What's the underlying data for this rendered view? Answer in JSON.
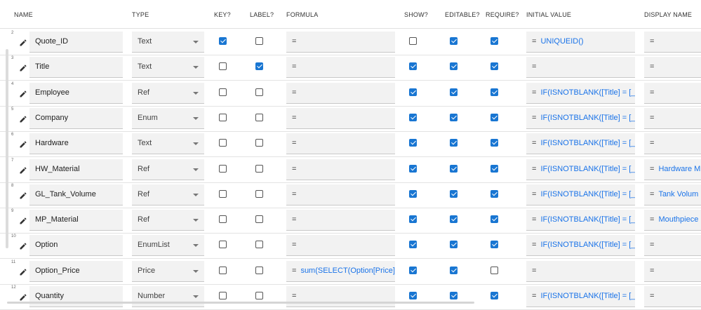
{
  "columns": {
    "name": "NAME",
    "type": "TYPE",
    "key": "KEY?",
    "label": "LABEL?",
    "formula": "FORMULA",
    "show": "SHOW?",
    "editable": "EDITABLE?",
    "require": "REQUIRE?",
    "initial": "INITIAL VALUE",
    "display": "DISPLAY NAME"
  },
  "eq": "=",
  "colors": {
    "accent": "#1976d2",
    "expression": "#1a73e8"
  },
  "rows": [
    {
      "num": "2",
      "name": "Quote_ID",
      "type": "Text",
      "key": true,
      "label": false,
      "formula": "",
      "show": false,
      "editable": true,
      "require": true,
      "initial": "UNIQUEID()",
      "display": ""
    },
    {
      "num": "3",
      "name": "Title",
      "type": "Text",
      "key": false,
      "label": true,
      "formula": "",
      "show": true,
      "editable": true,
      "require": true,
      "initial": "",
      "display": ""
    },
    {
      "num": "4",
      "name": "Employee",
      "type": "Ref",
      "key": false,
      "label": false,
      "formula": "",
      "show": true,
      "editable": true,
      "require": true,
      "initial": "IF(ISNOTBLANK([Title] = [_TI",
      "display": ""
    },
    {
      "num": "5",
      "name": "Company",
      "type": "Enum",
      "key": false,
      "label": false,
      "formula": "",
      "show": true,
      "editable": true,
      "require": true,
      "initial": "IF(ISNOTBLANK([Title] = [_TI",
      "display": ""
    },
    {
      "num": "6",
      "name": "Hardware",
      "type": "Text",
      "key": false,
      "label": false,
      "formula": "",
      "show": true,
      "editable": true,
      "require": true,
      "initial": "IF(ISNOTBLANK([Title] = [_TI",
      "display": ""
    },
    {
      "num": "7",
      "name": "HW_Material",
      "type": "Ref",
      "key": false,
      "label": false,
      "formula": "",
      "show": true,
      "editable": true,
      "require": true,
      "initial": "IF(ISNOTBLANK([Title] = [_TI",
      "display": "Hardware M"
    },
    {
      "num": "8",
      "name": "GL_Tank_Volume",
      "type": "Ref",
      "key": false,
      "label": false,
      "formula": "",
      "show": true,
      "editable": true,
      "require": true,
      "initial": "IF(ISNOTBLANK([Title] = [_TI",
      "display": "Tank Volum"
    },
    {
      "num": "9",
      "name": "MP_Material",
      "type": "Ref",
      "key": false,
      "label": false,
      "formula": "",
      "show": true,
      "editable": true,
      "require": true,
      "initial": "IF(ISNOTBLANK([Title] = [_TI",
      "display": "Mouthpiece"
    },
    {
      "num": "10",
      "name": "Option",
      "type": "EnumList",
      "key": false,
      "label": false,
      "formula": "",
      "show": true,
      "editable": true,
      "require": true,
      "initial": "IF(ISNOTBLANK([Title] = [_TI",
      "display": ""
    },
    {
      "num": "11",
      "name": "Option_Price",
      "type": "Price",
      "key": false,
      "label": false,
      "formula": "sum(SELECT(Option[Price], I",
      "show": true,
      "editable": true,
      "require": false,
      "initial": "",
      "display": ""
    },
    {
      "num": "12",
      "name": "Quantity",
      "type": "Number",
      "key": false,
      "label": false,
      "formula": "",
      "show": true,
      "editable": true,
      "require": true,
      "initial": "IF(ISNOTBLANK([Title] = [_TI",
      "display": ""
    }
  ]
}
